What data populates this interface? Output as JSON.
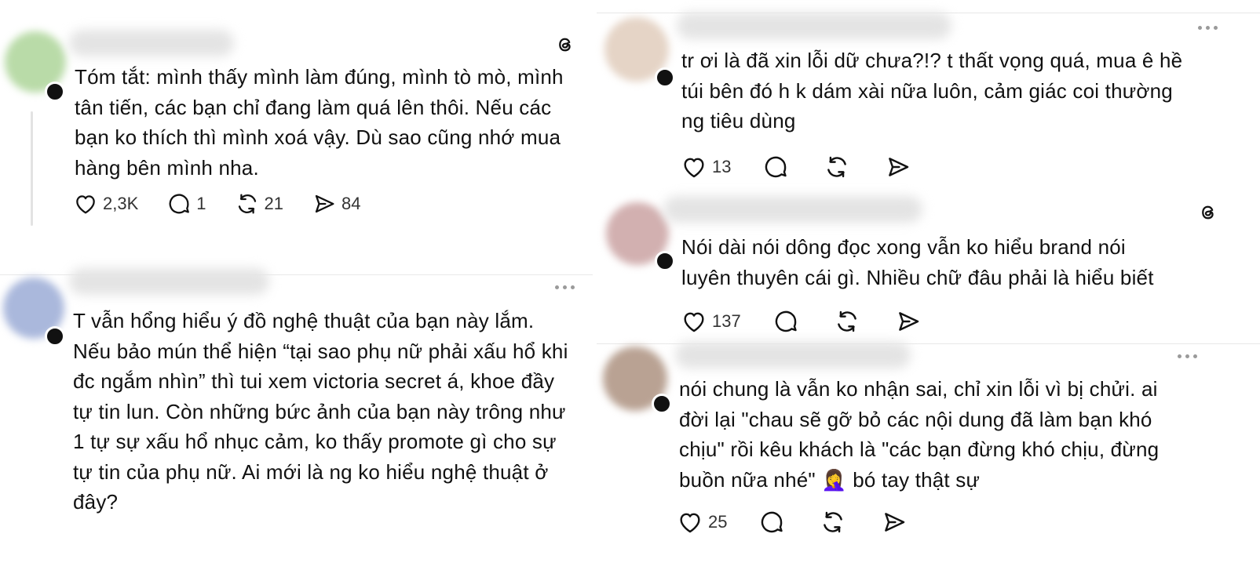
{
  "posts": [
    {
      "text": "Tóm tắt: mình thấy mình làm đúng, mình tò mò, mình\ntân tiến, các bạn chỉ đang làm quá lên thôi. Nếu các\nbạn ko thích thì mình xoá vậy. Dù sao cũng nhớ mua\nhàng bên mình nha.",
      "likes": "2,3K",
      "replies": "1",
      "reposts": "21",
      "shares": "84"
    },
    {
      "text": "T vẫn hổng hiểu ý đồ nghệ thuật của bạn này lắm.\nNếu bảo mún thể hiện “tại sao phụ nữ phải xấu hổ khi\nđc ngắm nhìn” thì tui xem victoria secret á, khoe đầy\ntự tin lun. Còn những bức ảnh của bạn này trông như\n1 tự sự xấu hổ nhục cảm, ko thấy promote gì cho sự\ntự tin của phụ nữ. Ai mới là ng ko hiểu nghệ thuật ở\nđây?"
    },
    {
      "text": "tr ơi là đã xin lỗi dữ chưa?!? t thất vọng quá, mua ê hề\ntúi bên đó h k dám xài nữa luôn, cảm giác coi thường\nng tiêu dùng",
      "likes": "13"
    },
    {
      "text": "Nói dài nói dông đọc xong vẫn ko hiểu brand nói\nluyên thuyên cái gì. Nhiều chữ đâu phải là hiểu biết",
      "likes": "137"
    },
    {
      "text": "nói chung là vẫn ko nhận sai, chỉ xin lỗi vì bị chửi. ai\nđời lại \"chau sẽ gỡ bỏ các nội dung đã làm bạn khó\nchịu\" rồi kêu khách là \"các bạn đừng khó chịu, đừng\nbuồn nữa nhé\" 🤦‍♀️ bó tay thật sự",
      "likes": "25"
    }
  ],
  "icons": [
    "heart-icon",
    "reply-icon",
    "repost-icon",
    "share-icon",
    "threads-logo-icon",
    "more-options-icon"
  ],
  "colors": {
    "text": "#111111",
    "muted": "#333333",
    "divider": "#e8e8e8"
  }
}
